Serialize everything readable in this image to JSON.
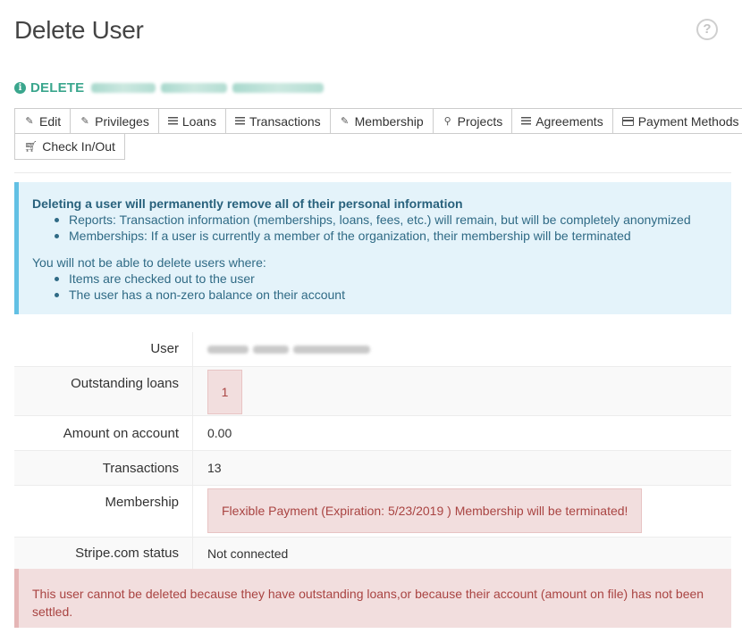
{
  "header": {
    "title": "Delete User",
    "help_icon": "question-circle-icon",
    "help_glyph": "?"
  },
  "delete_heading": {
    "icon": "info-circle-icon",
    "icon_glyph": "i",
    "label": "DELETE",
    "accent_color": "#3aa68d"
  },
  "tabs": [
    {
      "label": "Edit",
      "icon": "pencil-icon"
    },
    {
      "label": "Privileges",
      "icon": "pencil-icon"
    },
    {
      "label": "Loans",
      "icon": "list-icon"
    },
    {
      "label": "Transactions",
      "icon": "list-icon"
    },
    {
      "label": "Membership",
      "icon": "pencil-icon"
    },
    {
      "label": "Projects",
      "icon": "pin-icon"
    },
    {
      "label": "Agreements",
      "icon": "list-icon"
    },
    {
      "label": "Payment Methods",
      "icon": "credit-card-icon"
    },
    {
      "label": "Check In/Out",
      "icon": "shopping-cart-icon"
    }
  ],
  "info_box": {
    "heading": "Deleting a user will permanently remove all of their personal information",
    "points": [
      "Reports: Transaction information (memberships, loans, fees, etc.) will remain, but will be completely anonymized",
      "Memberships: If a user is currently a member of the organization, their membership will be terminated"
    ],
    "restriction_intro": "You will not be able to delete users where:",
    "restrictions": [
      "Items are checked out to the user",
      "The user has a non-zero balance on their account"
    ]
  },
  "details": {
    "user_label": "User",
    "outstanding_loans_label": "Outstanding loans",
    "outstanding_loans_value": "1",
    "amount_label": "Amount on account",
    "amount_value": "0.00",
    "transactions_label": "Transactions",
    "transactions_value": "13",
    "membership_label": "Membership",
    "membership_value": "Flexible Payment (Expiration: 5/23/2019 ) Membership will be terminated!",
    "stripe_label": "Stripe.com status",
    "stripe_value": "Not connected"
  },
  "error_box": {
    "message": "This user cannot be deleted because they have outstanding loans,or because their account (amount on file) has not been settled."
  }
}
